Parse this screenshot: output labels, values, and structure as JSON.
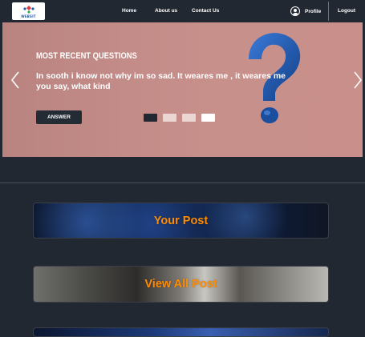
{
  "navbar": {
    "logo_text": "WEBSIT",
    "links": {
      "home": "Home",
      "about": "About us",
      "contact": "Contact Us"
    },
    "profile_label": "Profile",
    "logout_label": "Logout"
  },
  "hero": {
    "title": "MOST RECENT QUESTIONS",
    "question": "In sooth i know not why im so sad. It weares me , it weares me you say, what kind",
    "answer_button": "ANSWER",
    "active_slide": 1,
    "slide_count": 4
  },
  "cards": {
    "your_post": "Your Post",
    "view_all_post": "View All Post"
  },
  "colors": {
    "background": "#222831",
    "accent_orange": "#ff8c00",
    "hero_bg": "#c38c88",
    "qmark_blue": "#1e5aa8"
  }
}
